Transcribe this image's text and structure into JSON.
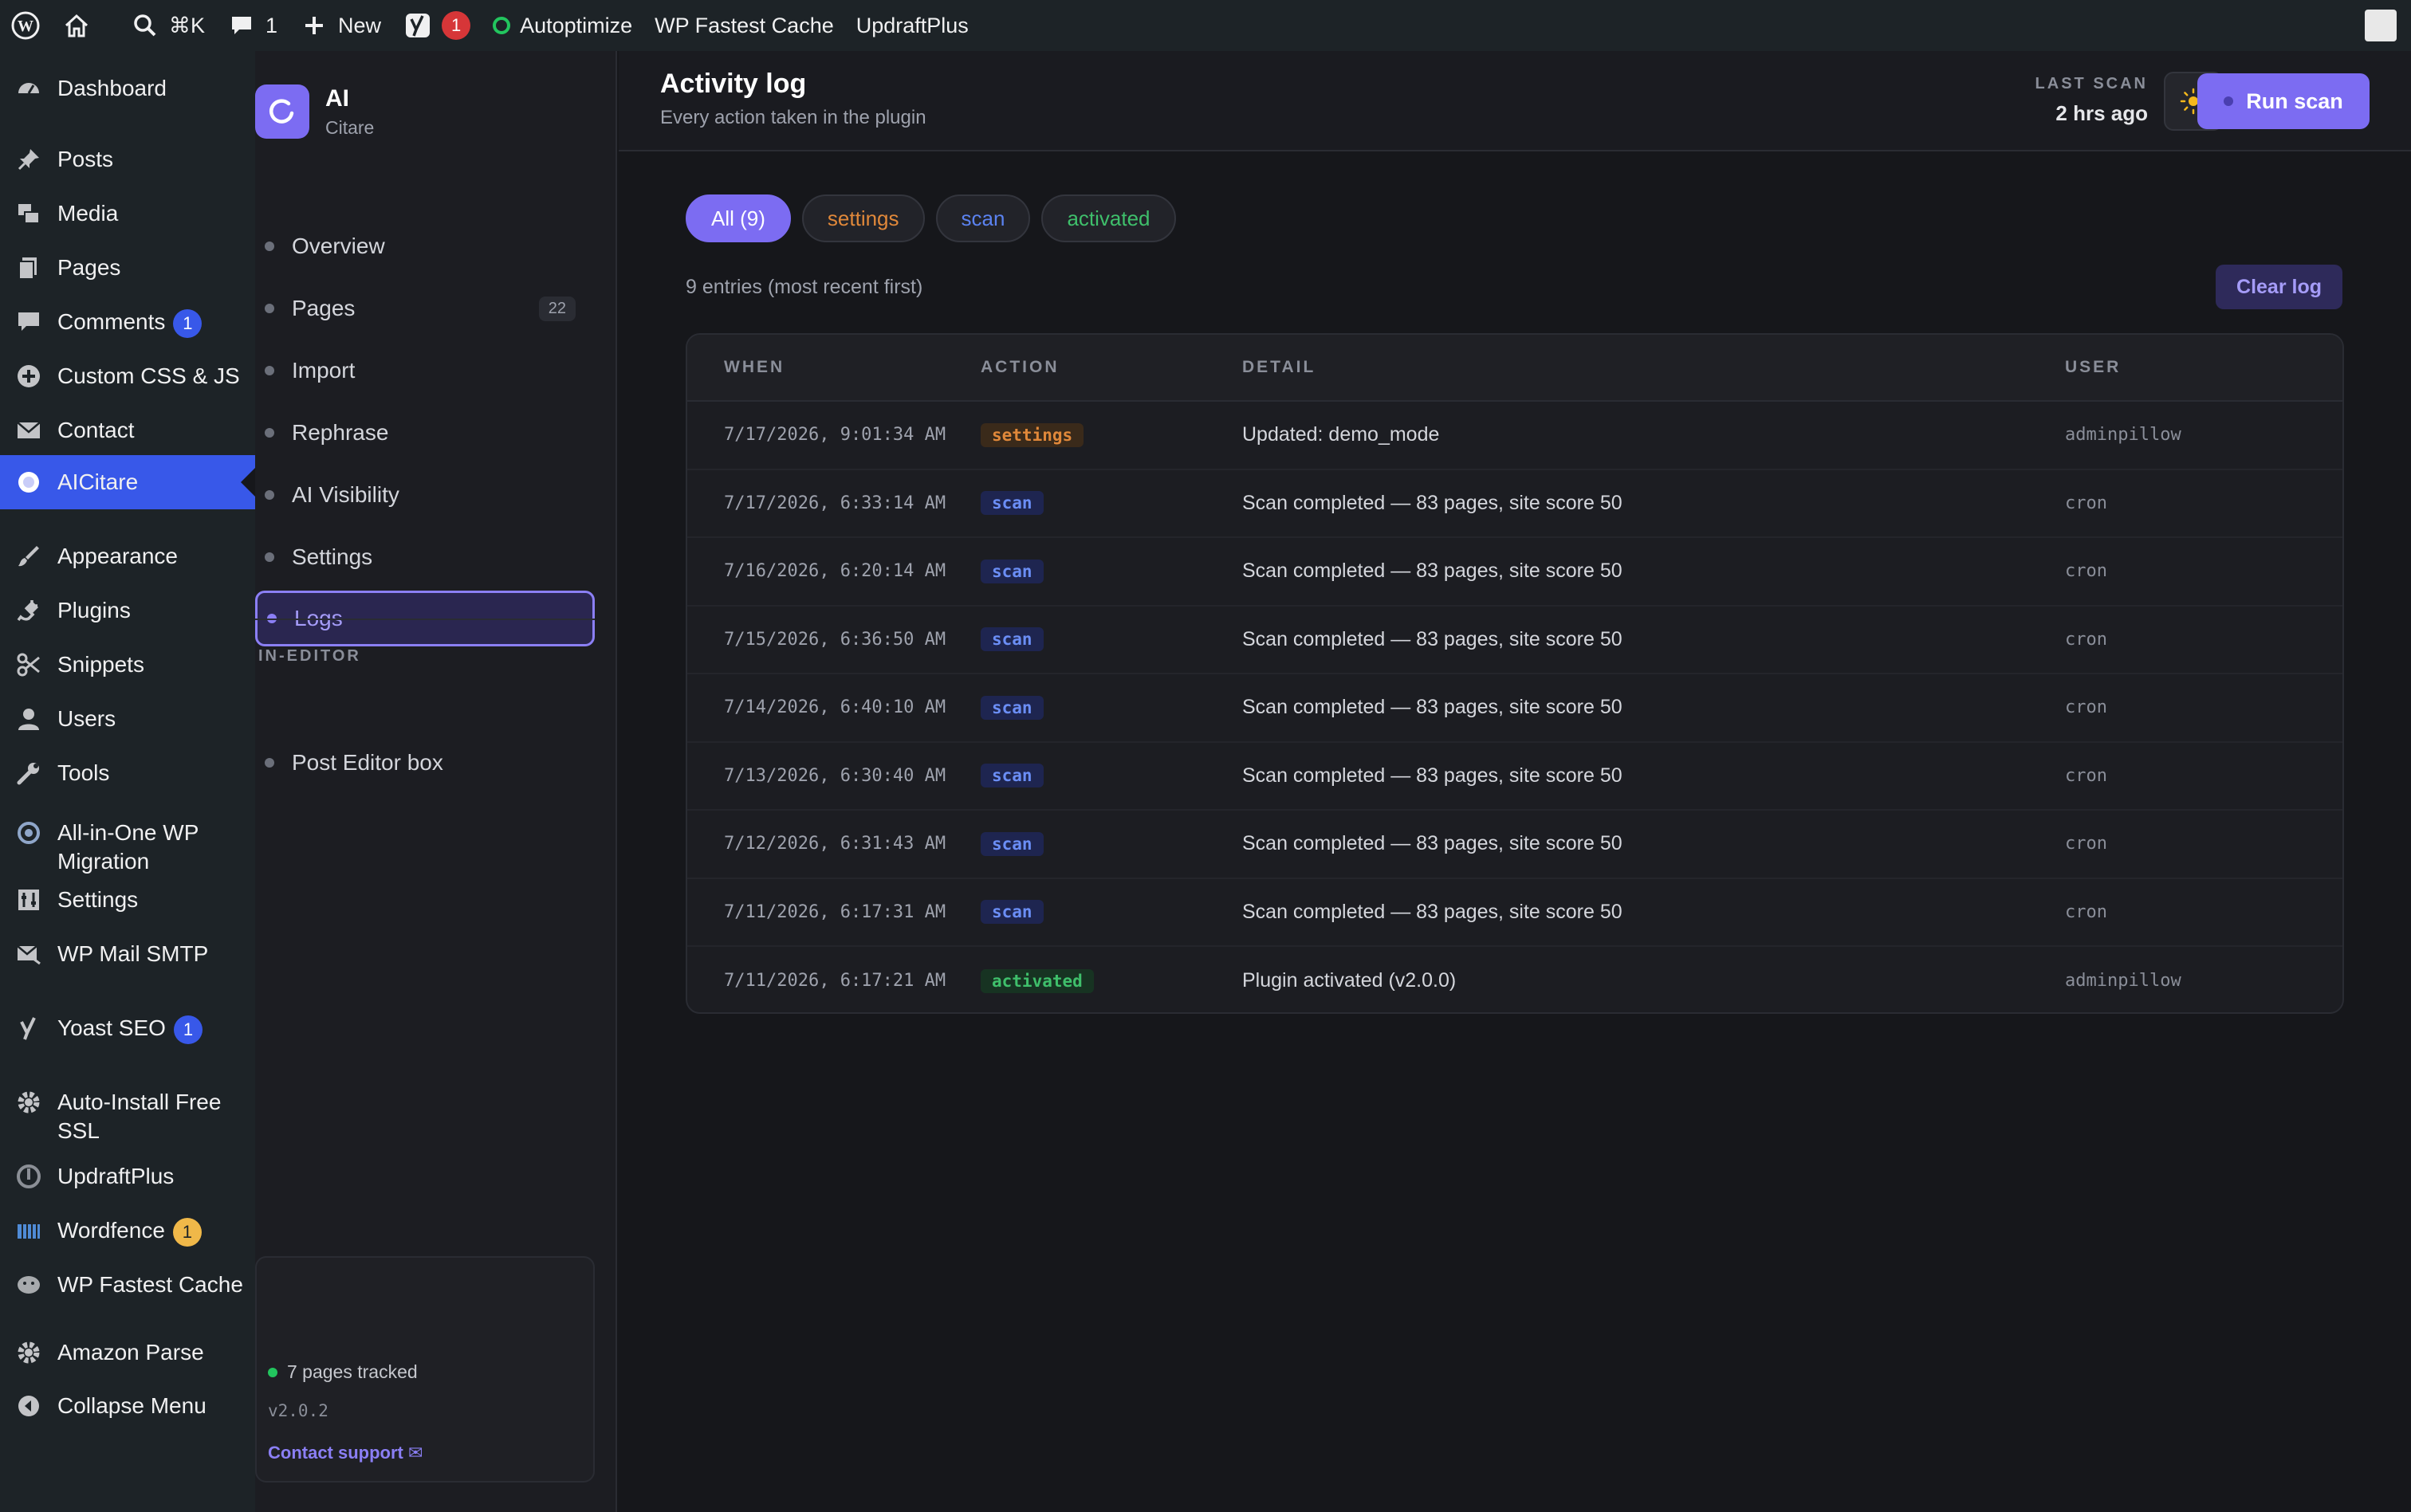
{
  "admin_bar": {
    "search_shortcut": "⌘K",
    "comments_count": "1",
    "new_label": "New",
    "yoast_badge": "1",
    "autoptimize": "Autoptimize",
    "wp_fastest_cache": "WP Fastest Cache",
    "updraftplus": "UpdraftPlus"
  },
  "wp_menu": [
    {
      "label": "Dashboard",
      "icon": "dashboard-icon"
    },
    {
      "label": "Posts",
      "icon": "pin-icon"
    },
    {
      "label": "Media",
      "icon": "media-icon"
    },
    {
      "label": "Pages",
      "icon": "pages-icon"
    },
    {
      "label": "Comments",
      "icon": "comment-icon",
      "badge": "1"
    },
    {
      "label": "Custom CSS & JS",
      "icon": "plus-circle-icon"
    },
    {
      "label": "Contact",
      "icon": "mail-icon"
    },
    {
      "label": "AICitare",
      "icon": "aicitare-icon",
      "active": true
    },
    {
      "label": "Appearance",
      "icon": "brush-icon"
    },
    {
      "label": "Plugins",
      "icon": "plug-icon"
    },
    {
      "label": "Snippets",
      "icon": "scissors-icon"
    },
    {
      "label": "Users",
      "icon": "user-icon"
    },
    {
      "label": "Tools",
      "icon": "wrench-icon"
    },
    {
      "label": "All-in-One WP Migration",
      "icon": "migration-icon"
    },
    {
      "label": "Settings",
      "icon": "settings-sliders-icon"
    },
    {
      "label": "WP Mail SMTP",
      "icon": "mail-smtp-icon"
    },
    {
      "label": "Yoast SEO",
      "icon": "yoast-icon",
      "badge": "1"
    },
    {
      "label": "Auto-Install Free SSL",
      "icon": "gear-icon"
    },
    {
      "label": "UpdraftPlus",
      "icon": "updraft-icon"
    },
    {
      "label": "Wordfence",
      "icon": "wordfence-icon",
      "badge": "1",
      "badge_color": "#f0b849"
    },
    {
      "label": "WP Fastest Cache",
      "icon": "cheetah-icon"
    },
    {
      "label": "Amazon Parse",
      "icon": "gear-icon"
    },
    {
      "label": "Collapse Menu",
      "icon": "collapse-icon"
    }
  ],
  "plugin": {
    "brand_title": "AI",
    "brand_subtitle": "Citare",
    "nav": [
      {
        "label": "Overview"
      },
      {
        "label": "Pages",
        "count": "22"
      },
      {
        "label": "Import"
      },
      {
        "label": "Rephrase"
      },
      {
        "label": "AI Visibility"
      },
      {
        "label": "Settings"
      },
      {
        "label": "Logs",
        "active": true
      }
    ],
    "section_label": "IN-EDITOR",
    "editor_item": "Post Editor box",
    "footer": {
      "tracked": "7 pages tracked",
      "version": "v2.0.2",
      "support": "Contact support ✉"
    }
  },
  "header": {
    "title": "Activity log",
    "subtitle": "Every action taken in the plugin",
    "last_scan_label": "LAST SCAN",
    "last_scan_value": "2 hrs ago",
    "run_scan_label": "Run scan"
  },
  "filters": [
    {
      "label": "All (9)",
      "kind": "all"
    },
    {
      "label": "settings",
      "kind": "settings"
    },
    {
      "label": "scan",
      "kind": "scan"
    },
    {
      "label": "activated",
      "kind": "activated"
    }
  ],
  "entries_text": "9 entries (most recent first)",
  "clear_log_label": "Clear log",
  "table": {
    "columns": [
      "WHEN",
      "ACTION",
      "DETAIL",
      "USER"
    ],
    "rows": [
      {
        "when": "7/17/2026, 9:01:34 AM",
        "action": "settings",
        "detail": "Updated: demo_mode",
        "user": "adminpillow"
      },
      {
        "when": "7/17/2026, 6:33:14 AM",
        "action": "scan",
        "detail": "Scan completed — 83 pages, site score 50",
        "user": "cron"
      },
      {
        "when": "7/16/2026, 6:20:14 AM",
        "action": "scan",
        "detail": "Scan completed — 83 pages, site score 50",
        "user": "cron"
      },
      {
        "when": "7/15/2026, 6:36:50 AM",
        "action": "scan",
        "detail": "Scan completed — 83 pages, site score 50",
        "user": "cron"
      },
      {
        "when": "7/14/2026, 6:40:10 AM",
        "action": "scan",
        "detail": "Scan completed — 83 pages, site score 50",
        "user": "cron"
      },
      {
        "when": "7/13/2026, 6:30:40 AM",
        "action": "scan",
        "detail": "Scan completed — 83 pages, site score 50",
        "user": "cron"
      },
      {
        "when": "7/12/2026, 6:31:43 AM",
        "action": "scan",
        "detail": "Scan completed — 83 pages, site score 50",
        "user": "cron"
      },
      {
        "when": "7/11/2026, 6:17:31 AM",
        "action": "scan",
        "detail": "Scan completed — 83 pages, site score 50",
        "user": "cron"
      },
      {
        "when": "7/11/2026, 6:17:21 AM",
        "action": "activated",
        "detail": "Plugin activated (v2.0.0)",
        "user": "adminpillow"
      }
    ]
  }
}
